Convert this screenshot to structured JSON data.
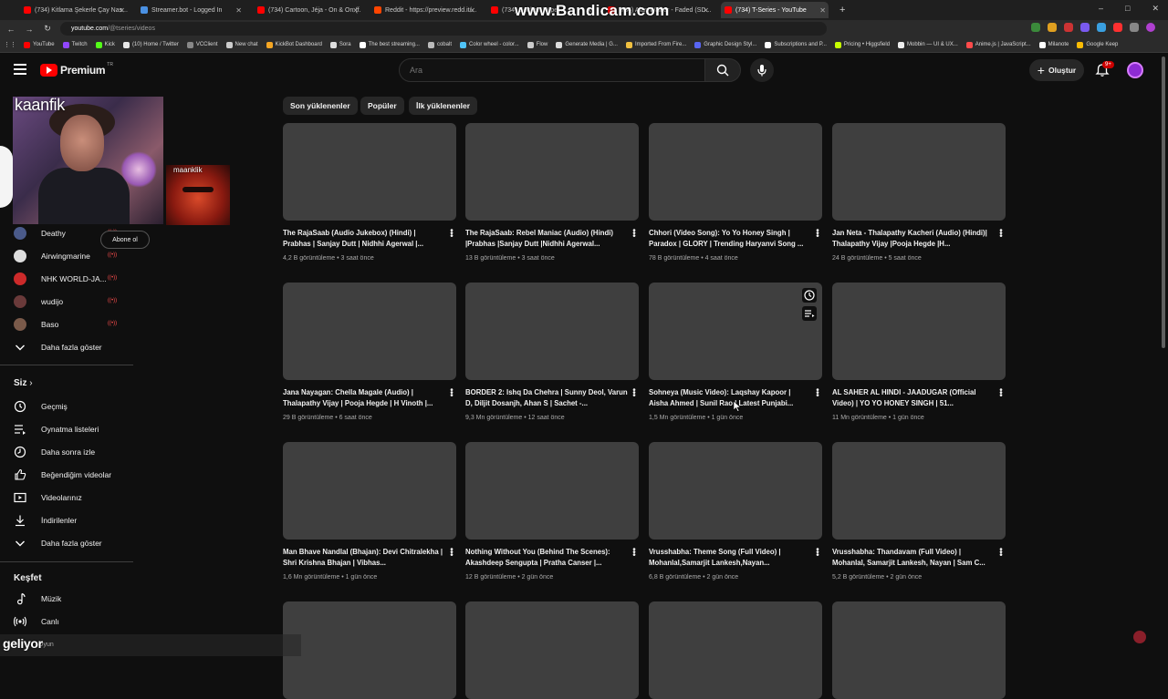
{
  "browser": {
    "tabs": [
      {
        "title": "(734) Kitlama Şekerle Çay Nas...",
        "color": "#ff0000"
      },
      {
        "title": "Streamer.bot - Logged In",
        "color": "#4a90e2"
      },
      {
        "title": "(734) Cartoon, Jéja - On & On (f...",
        "color": "#ff0000"
      },
      {
        "title": "Reddit - https://preview.redd.it/...",
        "color": "#ff4500"
      },
      {
        "title": "(734) Gökhan Küpel...",
        "color": "#ff0000"
      },
      {
        "title": "(734) Alan Walker - Faded (SD...",
        "color": "#ff0000"
      },
      {
        "title": "(734) T-Series - YouTube",
        "color": "#ff0000"
      }
    ],
    "watermark": "www.Bandicam.com",
    "url_host": "youtube.com",
    "url_path": "/@tseries/videos",
    "bookmarks": [
      {
        "label": "YouTube",
        "color": "#ff0000"
      },
      {
        "label": "Twitch",
        "color": "#9146ff"
      },
      {
        "label": "Kick",
        "color": "#53fc18"
      },
      {
        "label": "(10) Home / Twitter",
        "color": "#e7e7e7"
      },
      {
        "label": "VCClient",
        "color": "#888888"
      },
      {
        "label": "New chat",
        "color": "#cccccc"
      },
      {
        "label": "KickBot Dashboard",
        "color": "#f5a623"
      },
      {
        "label": "Sora",
        "color": "#dddddd"
      },
      {
        "label": "The best streaming...",
        "color": "#ffffff"
      },
      {
        "label": "cobalt",
        "color": "#bbbbbb"
      },
      {
        "label": "Color wheel - color...",
        "color": "#4fc3f7"
      },
      {
        "label": "Flow",
        "color": "#cccccc"
      },
      {
        "label": "Generate Media | G...",
        "color": "#dddddd"
      },
      {
        "label": "Imported From Fire...",
        "color": "#f0c040"
      },
      {
        "label": "Graphic Design Styl...",
        "color": "#5865f2"
      },
      {
        "label": "Subscriptions and P...",
        "color": "#ffffff"
      },
      {
        "label": "Pricing • Higgsfield",
        "color": "#c6ff00"
      },
      {
        "label": "Mobbin — UI & UX...",
        "color": "#eeeeee"
      },
      {
        "label": "Anime.js | JavaScript...",
        "color": "#ff4b4b"
      },
      {
        "label": "Milanote",
        "color": "#ffffff"
      },
      {
        "label": "Google Keep",
        "color": "#fbbc04"
      }
    ]
  },
  "masthead": {
    "logo_text": "Premium",
    "logo_region": "TR",
    "search_placeholder": "Ara",
    "create_label": "Oluştur",
    "notif_count": "9+"
  },
  "stream_overlay": {
    "cam_name": "kaanfik",
    "cam2_name": "maanklik",
    "subscribe_label": "Abone ol",
    "bottom_text": "geliyor",
    "bottom_under": "Oyun"
  },
  "sidebar": {
    "subscriptions": [
      {
        "name": "Deathy",
        "color": "#4a5a8a"
      },
      {
        "name": "Airwingmarine",
        "color": "#dddddd"
      },
      {
        "name": "NHK WORLD-JA...",
        "color": "#cc2a2a"
      },
      {
        "name": "wudijo",
        "color": "#6a3a3a"
      },
      {
        "name": "Baso",
        "color": "#7a5a4a"
      }
    ],
    "show_more": "Daha fazla göster",
    "you_header": "Siz",
    "you_items": [
      {
        "label": "Geçmiş",
        "icon": "history-icon"
      },
      {
        "label": "Oynatma listeleri",
        "icon": "playlists-icon"
      },
      {
        "label": "Daha sonra izle",
        "icon": "watch-later-icon"
      },
      {
        "label": "Beğendiğim videolar",
        "icon": "like-icon"
      },
      {
        "label": "Videolarınız",
        "icon": "your-videos-icon"
      },
      {
        "label": "İndirilenler",
        "icon": "download-icon"
      }
    ],
    "show_more_2": "Daha fazla göster",
    "explore_header": "Keşfet",
    "explore_items": [
      {
        "label": "Müzik",
        "icon": "music-icon"
      },
      {
        "label": "Canlı",
        "icon": "live-icon"
      }
    ]
  },
  "chips": [
    "Son yüklenenler",
    "Popüler",
    "İlk yüklenenler"
  ],
  "videos": [
    {
      "title": "The RajaSaab (Audio Jukebox) (Hindi) | Prabhas | Sanjay Dutt | Nidhhi Agerwal |...",
      "meta": "4,2 B görüntüleme • 3 saat önce"
    },
    {
      "title": "The RajaSaab: Rebel Maniac (Audio) (Hindi) |Prabhas |Sanjay Dutt |Nidhhi Agerwal...",
      "meta": "13 B görüntüleme • 3 saat önce"
    },
    {
      "title": "Chhori (Video Song): Yo Yo Honey Singh | Paradox | GLORY | Trending Haryanvi Song ...",
      "meta": "78 B görüntüleme • 4 saat önce"
    },
    {
      "title": "Jan Neta - Thalapathy Kacheri (Audio) (Hindi)| Thalapathy Vijay |Pooja Hegde |H...",
      "meta": "24 B görüntüleme • 5 saat önce"
    },
    {
      "title": "Jana Nayagan: Chella Magale (Audio) | Thalapathy Vijay | Pooja Hegde | H Vinoth |...",
      "meta": "29 B görüntüleme • 6 saat önce"
    },
    {
      "title": "BORDER 2: Ishq Da Chehra | Sunny Deol, Varun D, Diljit Dosanjh, Ahan S | Sachet -...",
      "meta": "9,3 Mn görüntüleme • 12 saat önce"
    },
    {
      "title": "Sohneya (Music Video): Laqshay Kapoor | Aisha Ahmed | Sunil Rao | Latest Punjabi...",
      "meta": "1,5 Mn görüntüleme • 1 gün önce"
    },
    {
      "title": "AL SAHER AL HINDI - JAADUGAR (Official Video) | YO YO HONEY SINGH | 51...",
      "meta": "11 Mn görüntüleme • 1 gün önce"
    },
    {
      "title": "Man Bhave Nandlal (Bhajan): Devi Chitralekha | Shri Krishna Bhajan | Vibhas...",
      "meta": "1,6 Mn görüntüleme • 1 gün önce"
    },
    {
      "title": "Nothing Without You (Behind The Scenes): Akashdeep Sengupta | Pratha Canser |...",
      "meta": "12 B görüntüleme • 2 gün önce"
    },
    {
      "title": "Vrusshabha: Theme Song (Full Video) | Mohanlal,Samarjit Lankesh,Nayan...",
      "meta": "6,8 B görüntüleme • 2 gün önce"
    },
    {
      "title": "Vrusshabha: Thandavam (Full Video) | Mohanlal, Samarjit Lankesh, Nayan | Sam C...",
      "meta": "5,2 B görüntüleme • 2 gün önce"
    },
    {
      "title": "",
      "meta": ""
    },
    {
      "title": "",
      "meta": ""
    },
    {
      "title": "",
      "meta": ""
    },
    {
      "title": "",
      "meta": ""
    }
  ],
  "colors": {
    "bg": "#0f0f0f",
    "thumb": "#3f3f3f",
    "accent": "#ff0000",
    "chip": "#272727"
  }
}
